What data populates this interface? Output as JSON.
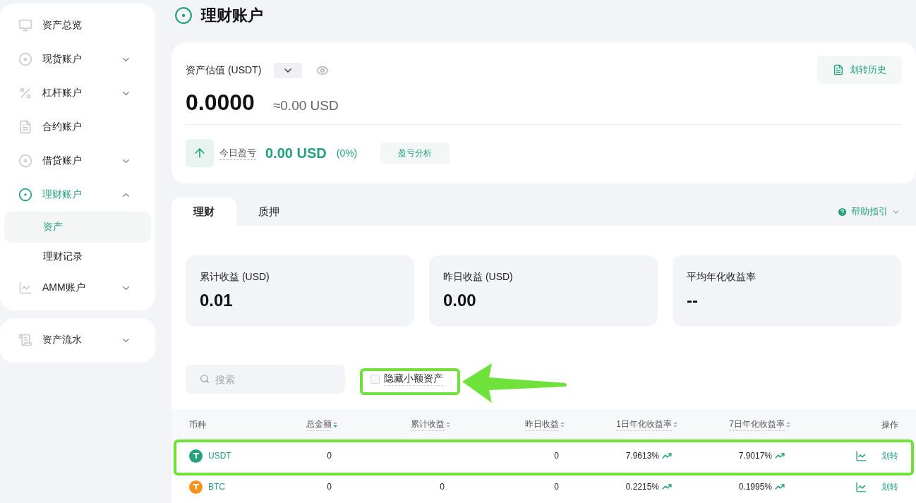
{
  "sidebar": {
    "groups": [
      {
        "items": [
          {
            "label": "资产总览",
            "selected": false
          },
          {
            "label": "现货账户",
            "selected": false,
            "expanded": false
          },
          {
            "label": "杠杆账户",
            "selected": false,
            "expanded": false
          },
          {
            "label": "合约账户",
            "selected": false
          },
          {
            "label": "借贷账户",
            "selected": false,
            "expanded": false
          },
          {
            "label": "理财账户",
            "selected": true,
            "expanded": true,
            "children": [
              {
                "label": "资产",
                "selected": true
              },
              {
                "label": "理财记录",
                "selected": false
              }
            ]
          },
          {
            "label": "AMM账户",
            "selected": false,
            "expanded": false
          }
        ]
      },
      {
        "items": [
          {
            "label": "资产流水",
            "selected": false,
            "expanded": false
          }
        ]
      }
    ]
  },
  "page_title": "理财账户",
  "summary": {
    "label": "资产估值 (USDT)",
    "value": "0.0000",
    "approx": "≈0.00 USD",
    "history_button": "划转历史",
    "pnl_label": "今日盈亏",
    "pnl_value": "0.00 USD",
    "pnl_percent": "(0%)",
    "analysis_button": "盈亏分析"
  },
  "tabs": [
    {
      "label": "理财",
      "selected": true
    },
    {
      "label": "质押",
      "selected": false
    }
  ],
  "help_link": "帮助指引",
  "stats": [
    {
      "label": "累计收益 (USD)",
      "value": "0.01"
    },
    {
      "label": "昨日收益 (USD)",
      "value": "0.00"
    },
    {
      "label": "平均年化收益率",
      "value": "--"
    }
  ],
  "search": {
    "placeholder": "搜索"
  },
  "hide_small": {
    "label": "隐藏小额资产",
    "checked": false
  },
  "table": {
    "columns": [
      {
        "label": "币种",
        "sortable": false
      },
      {
        "label": "总金额",
        "sortable": true,
        "sort_desc": true
      },
      {
        "label": "累计收益",
        "sortable": true,
        "sort_desc": false
      },
      {
        "label": "昨日收益",
        "sortable": true,
        "sort_desc": false
      },
      {
        "label": "1日年化收益率",
        "sortable": true,
        "sort_desc": false
      },
      {
        "label": "7日年化收益率",
        "sortable": true,
        "sort_desc": false
      },
      {
        "label": "操作",
        "sortable": false
      }
    ],
    "rows": [
      {
        "coin": "USDT",
        "color": "#26a17b",
        "total": "0",
        "yesterday": "0",
        "rate_1d": "7.9613%",
        "rate_7d": "7.9017%",
        "action": "划转"
      },
      {
        "coin": "BTC",
        "color": "#f7931a",
        "total": "0",
        "cumulative": "0",
        "yesterday": "0",
        "rate_1d": "0.2215%",
        "rate_7d": "0.1995%",
        "action": "划转"
      }
    ]
  }
}
